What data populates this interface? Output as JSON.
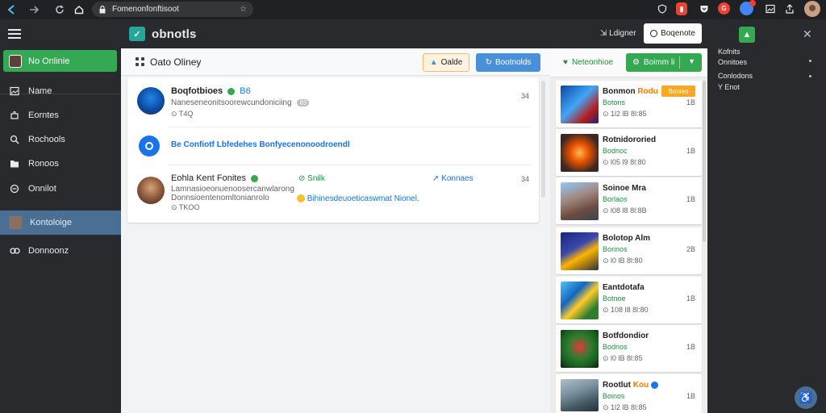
{
  "browser": {
    "url": "Fomenonfonftisoot",
    "extensions": [
      {
        "icon": "shield-icon",
        "color": "#bdc1c6"
      },
      {
        "icon": "red-app-icon",
        "color": "#ea4335"
      },
      {
        "icon": "pocket-icon",
        "color": "#bdc1c6"
      },
      {
        "icon": "g-icon",
        "color": "#ea4335"
      },
      {
        "icon": "globe-icon",
        "color": "#4285f4"
      },
      {
        "icon": "image-icon",
        "color": "#bdc1c6"
      },
      {
        "icon": "share-icon",
        "color": "#bdc1c6"
      }
    ]
  },
  "sidebar": {
    "online_label": "No Onlinie",
    "items": [
      {
        "label": "Name",
        "icon": "image-icon"
      },
      {
        "label": "Eorntes",
        "icon": "puzzle-icon"
      },
      {
        "label": "Rochools",
        "icon": "search-icon"
      },
      {
        "label": "Ronoos",
        "icon": "folder-icon"
      },
      {
        "label": "Onnilot",
        "icon": "circle-icon"
      },
      {
        "label": "Kontoloige",
        "icon": "avatar-icon"
      },
      {
        "label": "Donnoonz",
        "icon": "link-icon"
      }
    ]
  },
  "header": {
    "title": "obnotls",
    "sign_label": "Ldigner",
    "button_label": "Boqenote"
  },
  "main": {
    "title": "Oato Oliney",
    "btn_secondary": "Oalde",
    "btn_primary": "Bootnolds",
    "posts": [
      {
        "name": "Boqfotbioes",
        "tag": "B6",
        "line": "Naneseneonitsoorewcundoniciing",
        "badge": "83",
        "time": "T4Q",
        "side": "34"
      },
      {
        "link": "Be Confiotf Lbfedehes  Bonfyecenonoodroendl"
      },
      {
        "name": "Eohla Kent Fonites",
        "action1": "Snilk",
        "action2": "Konnaes",
        "side": "34",
        "line1": "Lamnasioeonuenoosercanwlarong",
        "line2": "Donnsioentenomltonianrolo",
        "time": "TKOO",
        "mention": "Bihinesdeuoeticaswmat Nionel."
      }
    ]
  },
  "games_panel": {
    "title": "Neteonhioe",
    "button_label": "Boimm li",
    "games": [
      {
        "name": "Bonmon",
        "name_hl": "Rodu",
        "tag": "Bonieo",
        "status": "Botons",
        "meta": "1l2 lB 8l:85",
        "num": "1B"
      },
      {
        "name": "Rotnidororied",
        "status": "Bodnoc",
        "meta": "l05 l9 8l:80",
        "num": "1B"
      },
      {
        "name": "Soinoe Mra",
        "status": "Borlaos",
        "meta": "l08 l8 8l:8B",
        "num": "1B"
      },
      {
        "name": "Bolotop Alm",
        "status": "Borinos",
        "meta": "l0 lB 8l:80",
        "num": "2B"
      },
      {
        "name": "Eantdotafa",
        "status": "Botnoe",
        "meta": "108 l8 8l:80",
        "num": "1B"
      },
      {
        "name": "Botfdondior",
        "status": "Bodnos",
        "meta": "l0 lB 8l:85",
        "num": "1B"
      },
      {
        "name": "Rootlut",
        "name_hl": "Kou",
        "status": "Boinos",
        "meta": "1l2 lB 8l:85",
        "num": "1B"
      }
    ]
  },
  "right_panel": {
    "lines": [
      "Kofnits",
      "Onnitoes",
      "Conlodons",
      "Y Enot"
    ]
  },
  "colors": {
    "accent_green": "#34a853",
    "accent_blue": "#4a90d9",
    "active_item": "#4a6f94",
    "dark_bg": "#292a2d"
  }
}
